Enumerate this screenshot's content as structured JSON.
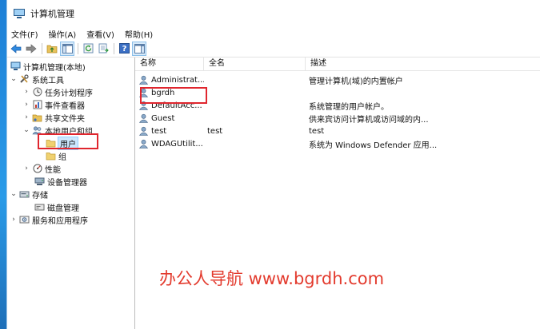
{
  "window": {
    "title": "计算机管理"
  },
  "menu": [
    "文件(F)",
    "操作(A)",
    "查看(V)",
    "帮助(H)"
  ],
  "toolbar": {
    "buttons": [
      "back-arrow-icon",
      "forward-arrow-icon",
      "up-folder-icon",
      "show-tree-icon",
      "refresh-icon",
      "export-list-icon",
      "help-icon",
      "properties-icon"
    ]
  },
  "tree": {
    "root": "计算机管理(本地)",
    "system_tools": "系统工具",
    "task_scheduler": "任务计划程序",
    "event_viewer": "事件查看器",
    "shared_folders": "共享文件夹",
    "local_users_groups": "本地用户和组",
    "users": "用户",
    "groups": "组",
    "performance": "性能",
    "device_manager": "设备管理器",
    "storage": "存储",
    "disk_management": "磁盘管理",
    "services_apps": "服务和应用程序"
  },
  "list": {
    "headers": {
      "name": "名称",
      "fullname": "全名",
      "description": "描述"
    },
    "rows": [
      {
        "name": "Administrat...",
        "fullname": "",
        "description": "管理计算机(域)的内置帐户"
      },
      {
        "name": "bgrdh",
        "fullname": "",
        "description": ""
      },
      {
        "name": "DefaultAcc...",
        "fullname": "",
        "description": "系统管理的用户帐户。"
      },
      {
        "name": "Guest",
        "fullname": "",
        "description": "供来宾访问计算机或访问域的内..."
      },
      {
        "name": "test",
        "fullname": "test",
        "description": "test"
      },
      {
        "name": "WDAGUtilit...",
        "fullname": "",
        "description": "系统为 Windows Defender 应用..."
      }
    ]
  },
  "watermark": "办公人导航 www.bgrdh.com",
  "colors": {
    "highlight_box": "#e0262e",
    "watermark": "#e33b2e",
    "selection": "#cce8ff"
  }
}
